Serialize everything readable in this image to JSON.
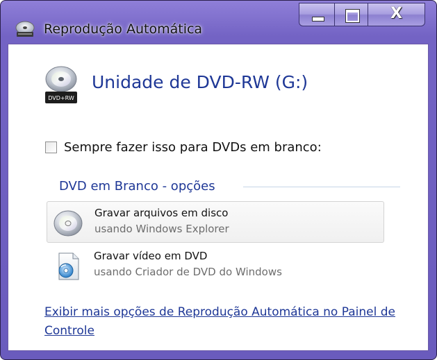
{
  "window": {
    "title": "Reprodução Automática"
  },
  "controls": {
    "minimize_icon": "minimize-icon",
    "maximize_icon": "maximize-icon",
    "close_symbol": "X"
  },
  "drive": {
    "title": "Unidade de DVD-RW (G:)",
    "icon_label": "DVD+RW"
  },
  "always_checkbox": {
    "label": "Sempre fazer isso para DVDs em branco:",
    "checked": false
  },
  "options_group": {
    "legend": "DVD em Branco - opções",
    "items": [
      {
        "title": "Gravar arquivos em disco",
        "subtitle": "usando Windows Explorer",
        "icon": "cd-disc-icon"
      },
      {
        "title": "Gravar vídeo em DVD",
        "subtitle": "usando Criador de DVD do Windows",
        "icon": "dvd-maker-icon"
      }
    ]
  },
  "footer_link": {
    "text": "Exibir mais opções de Reprodução Automática no Painel de Controle"
  },
  "colors": {
    "title_blue": "#1e3796",
    "frame": "#7363c4",
    "subtitle_gray": "#6d6d6d"
  }
}
